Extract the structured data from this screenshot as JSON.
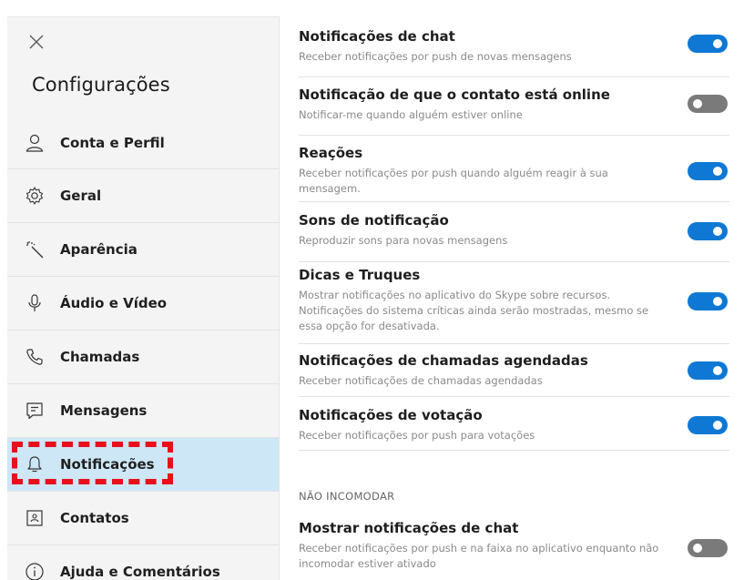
{
  "sidebar": {
    "title": "Configurações",
    "items": [
      {
        "label": "Conta e Perfil",
        "icon": "person-icon"
      },
      {
        "label": "Geral",
        "icon": "gear-icon"
      },
      {
        "label": "Aparência",
        "icon": "magic-wand-icon"
      },
      {
        "label": "Áudio e Vídeo",
        "icon": "microphone-icon"
      },
      {
        "label": "Chamadas",
        "icon": "phone-icon"
      },
      {
        "label": "Mensagens",
        "icon": "message-icon"
      },
      {
        "label": "Notificações",
        "icon": "bell-icon",
        "active": true
      },
      {
        "label": "Contatos",
        "icon": "contact-card-icon"
      },
      {
        "label": "Ajuda e Comentários",
        "icon": "info-icon"
      }
    ]
  },
  "settings": [
    {
      "title": "Notificações de chat",
      "desc": "Receber notificações por push de novas mensagens",
      "on": true
    },
    {
      "title": "Notificação de que o contato está online",
      "desc": "Notificar-me quando alguém estiver online",
      "on": false
    },
    {
      "title": "Reações",
      "desc": "Receber notificações por push quando alguém reagir à sua mensagem.",
      "on": true
    },
    {
      "title": "Sons de notificação",
      "desc": "Reproduzir sons para novas mensagens",
      "on": true
    },
    {
      "title": "Dicas e Truques",
      "desc": "Mostrar notificações no aplicativo do Skype sobre recursos. Notificações do sistema críticas ainda serão mostradas, mesmo se essa opção for desativada.",
      "on": true
    },
    {
      "title": "Notificações de chamadas agendadas",
      "desc": "Receber notificações de chamadas agendadas",
      "on": true
    },
    {
      "title": "Notificações de votação",
      "desc": "Receber notificações por push para votações",
      "on": true
    }
  ],
  "dnd": {
    "header": "NÃO INCOMODAR",
    "setting": {
      "title": "Mostrar notificações de chat",
      "desc": "Receber notificações por push e na faixa no aplicativo enquanto não incomodar estiver ativado",
      "on": false
    }
  },
  "colors": {
    "accent": "#0f78d4",
    "active_bg": "#cde7f7",
    "highlight": "#e8101b"
  }
}
